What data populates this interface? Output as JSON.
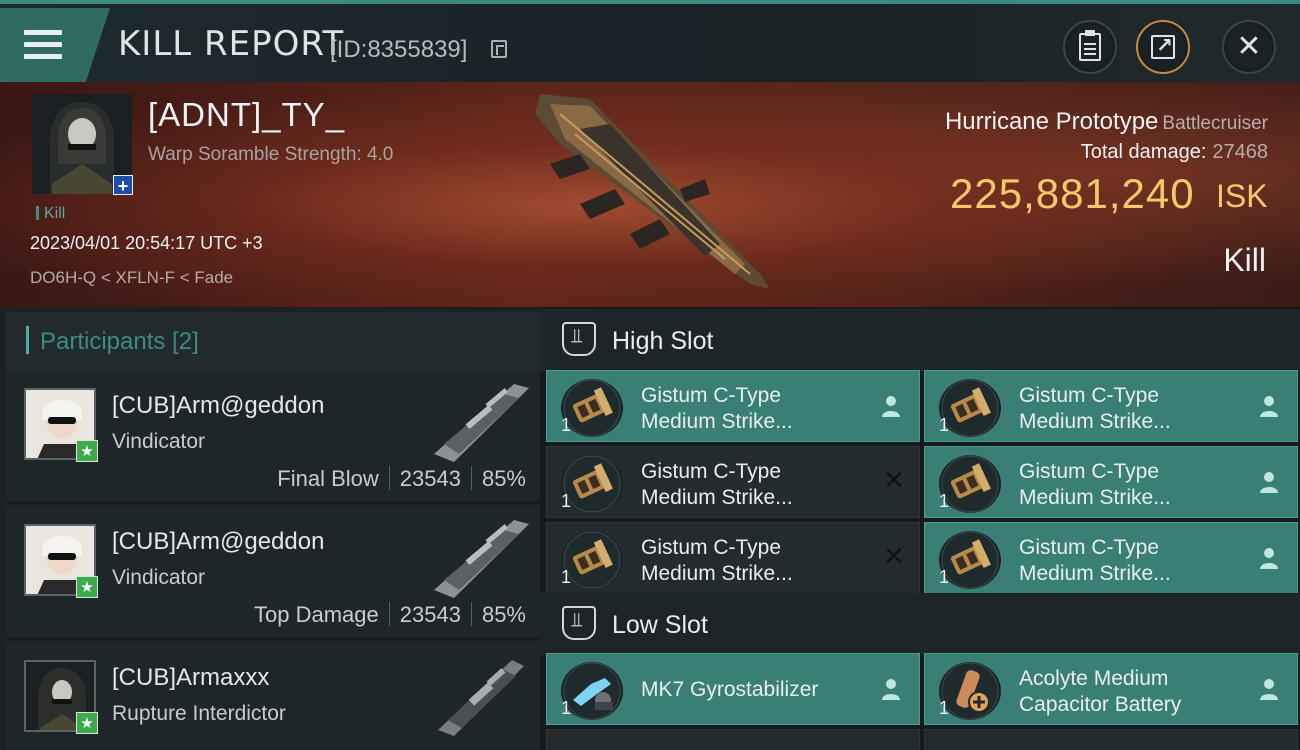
{
  "header": {
    "title": "KILL REPORT",
    "report_id": "[ID:8355839]",
    "icons": [
      "menu-icon",
      "copy-icon",
      "clipboard-icon",
      "share-icon",
      "close-icon"
    ]
  },
  "victim": {
    "name": "[ADNT]_TY_",
    "warp_scramble": "Warp Soramble Strength: 4.0",
    "tag": "Kill",
    "datetime": "2023/04/01 20:54:17 UTC +3",
    "location": "DO6H-Q < XFLN-F < Fade",
    "ship_name": "Hurricane Prototype",
    "ship_class": "Battlecruiser",
    "total_damage_label": "Total damage:",
    "total_damage": "27468",
    "isk_value": "225,881,240",
    "isk_unit": "ISK",
    "result": "Kill"
  },
  "participants": {
    "title": "Participants [2]",
    "items": [
      {
        "name": "[CUB]Arm@geddon",
        "ship": "Vindicator",
        "role": "Final Blow",
        "damage": "23543",
        "percent": "85%"
      },
      {
        "name": "[CUB]Arm@geddon",
        "ship": "Vindicator",
        "role": "Top Damage",
        "damage": "23543",
        "percent": "85%"
      },
      {
        "name": "[CUB]Armaxxx",
        "ship": "Rupture Interdictor",
        "role": "",
        "damage": "",
        "percent": ""
      }
    ]
  },
  "fitting": {
    "high_slot": {
      "title": "High Slot",
      "modules": [
        {
          "line1": "Gistum C-Type",
          "line2": "Medium Strike...",
          "qty": "1",
          "state": "pilot"
        },
        {
          "line1": "Gistum C-Type",
          "line2": "Medium Strike...",
          "qty": "1",
          "state": "pilot"
        },
        {
          "line1": "Gistum C-Type",
          "line2": "Medium Strike...",
          "qty": "1",
          "state": "x"
        },
        {
          "line1": "Gistum C-Type",
          "line2": "Medium Strike...",
          "qty": "1",
          "state": "pilot"
        },
        {
          "line1": "Gistum C-Type",
          "line2": "Medium Strike...",
          "qty": "1",
          "state": "x"
        },
        {
          "line1": "Gistum C-Type",
          "line2": "Medium Strike...",
          "qty": "1",
          "state": "pilot"
        }
      ]
    },
    "low_slot": {
      "title": "Low Slot",
      "modules": [
        {
          "line1": "MK7 Gyrostabilizer",
          "line2": "",
          "qty": "1",
          "state": "pilot"
        },
        {
          "line1": "Acolyte Medium",
          "line2": "Capacitor Battery",
          "qty": "1",
          "state": "pilot"
        }
      ]
    }
  },
  "colors": {
    "accent": "#3a7f75",
    "isk": "#f3c96b",
    "badge_blue": "#1c4fa5",
    "badge_green": "#3eaa4e"
  }
}
